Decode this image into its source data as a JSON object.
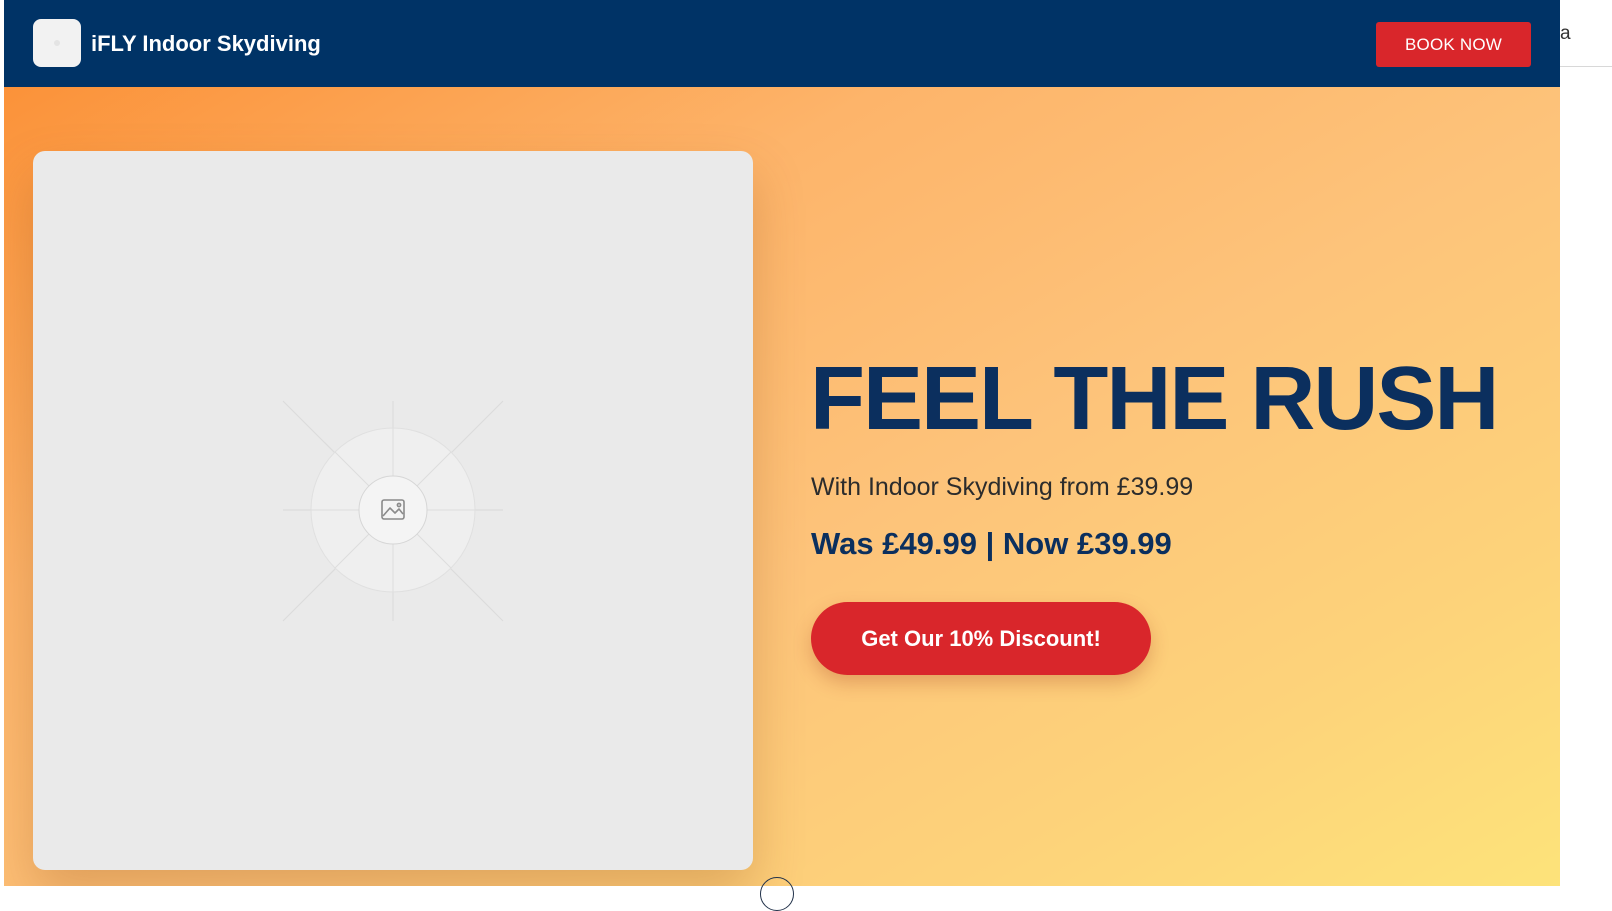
{
  "header": {
    "brand_name": "iFLY Indoor Skydiving",
    "book_button_label": "BOOK NOW",
    "logo_icon": "logo-placeholder-icon"
  },
  "hero": {
    "image_icon": "image-placeholder-icon",
    "headline": "FEEL THE RUSH",
    "subtitle": "With Indoor Skydiving from £39.99",
    "price_line": "Was £49.99 | Now £39.99",
    "cta_label": "Get Our 10% Discount!"
  },
  "page": {
    "edge_fragment": "a"
  },
  "colors": {
    "navbar": "#003366",
    "accent_red": "#d9262b",
    "headline_navy": "#0b2f5e",
    "gradient_start": "#fb9239",
    "gradient_end": "#fde37a"
  }
}
